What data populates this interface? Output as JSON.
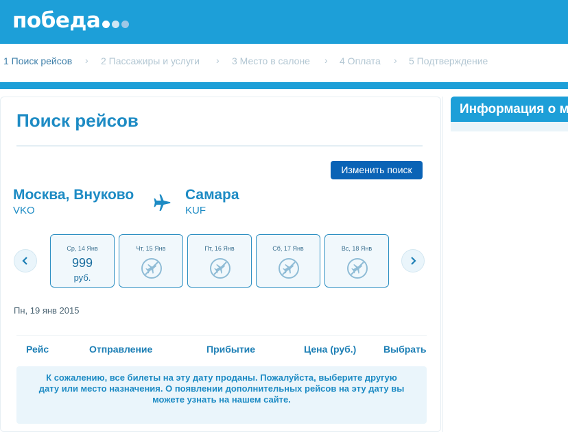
{
  "brand": {
    "name": "победа",
    "dot_colors": [
      "#ffffff",
      "#cfe6f4",
      "#9fc7e6"
    ]
  },
  "steps": [
    {
      "label": "1 Поиск рейсов",
      "active": true
    },
    {
      "label": "2 Пассажиры и услуги",
      "active": false
    },
    {
      "label": "3 Место в салоне",
      "active": false
    },
    {
      "label": "4 Оплата",
      "active": false
    },
    {
      "label": "5 Подтверждение",
      "active": false
    }
  ],
  "step_separator": "›",
  "sidebar": {
    "title": "Информация о м"
  },
  "search": {
    "title": "Поиск рейсов",
    "change_button": "Изменить поиск",
    "origin": {
      "city": "Москва, Внуково",
      "code": "VKO"
    },
    "destination": {
      "city": "Самара",
      "code": "KUF"
    },
    "prev_icon": "chevron-left-icon",
    "next_icon": "chevron-right-icon"
  },
  "days": [
    {
      "label": "Ср, 14 Янв",
      "price": "999",
      "currency": "руб.",
      "available": true
    },
    {
      "label": "Чт, 15 Янв",
      "available": false
    },
    {
      "label": "Пт, 16 Янв",
      "available": false
    },
    {
      "label": "Сб, 17 Янв",
      "available": false
    },
    {
      "label": "Вс, 18 Янв",
      "available": false
    }
  ],
  "selected_date": "Пн, 19 янв 2015",
  "table": {
    "headers": [
      "Рейс",
      "Отправление",
      "Прибытие",
      "Цена (руб.)",
      "Выбрать"
    ]
  },
  "notice": "К сожалению, все билеты на эту дату проданы. Пожалуйста, выберите другую дату или место назначения. О появлении дополнительных рейсов на эту дату вы можете узнать на нашем сайте.",
  "colors": {
    "brand_blue": "#1d9fd8",
    "button_blue": "#0a63b6",
    "text_blue": "#1d8bc4"
  }
}
